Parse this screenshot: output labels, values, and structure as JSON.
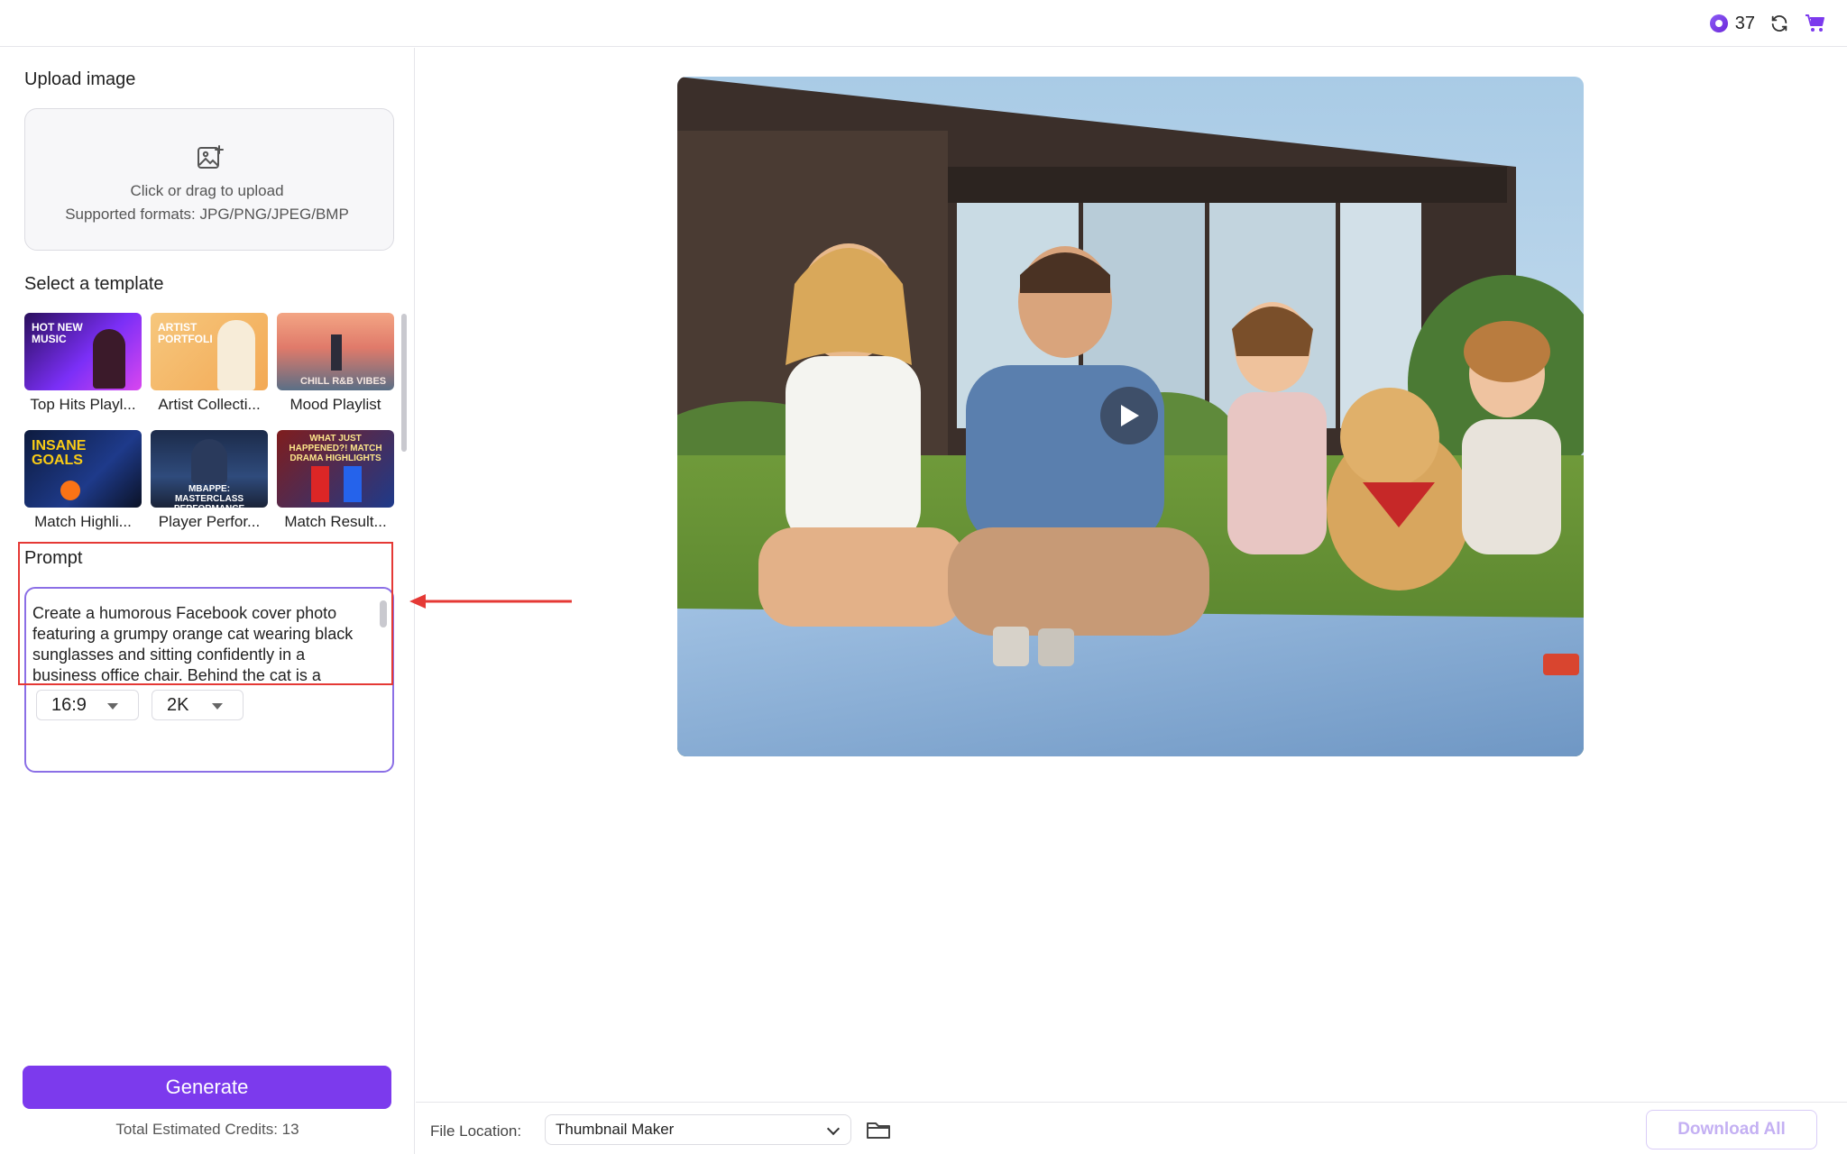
{
  "topbar": {
    "credits": "37",
    "icons": [
      "credit-gem-icon",
      "refresh-icon",
      "cart-icon"
    ]
  },
  "upload": {
    "title": "Upload image",
    "main_text": "Click or drag to upload",
    "formats_text": "Supported formats: JPG/PNG/JPEG/BMP",
    "icon": "image-add-icon"
  },
  "templates": {
    "title": "Select a template",
    "items": [
      {
        "label": "Top Hits Playl...",
        "thumb_text": "HOT NEW MUSIC"
      },
      {
        "label": "Artist Collecti...",
        "thumb_text": "ARTIST PORTFOLI"
      },
      {
        "label": "Mood Playlist",
        "thumb_text": "CHILL R&B VIBES"
      },
      {
        "label": "Match Highli...",
        "thumb_text": "INSANE GOALS"
      },
      {
        "label": "Player Perfor...",
        "thumb_text": "MBAPPE: MASTERCLASS PERFORMANCE"
      },
      {
        "label": "Match Result...",
        "thumb_text": "WHAT JUST HAPPENED?! MATCH DRAMA HIGHLIGHTS"
      }
    ]
  },
  "prompt": {
    "title": "Prompt",
    "text": "Create a humorous Facebook cover photo featuring a grumpy orange cat wearing black sunglasses and sitting confidently in a business office chair. Behind the cat is a",
    "aspect_ratio": "16:9",
    "resolution": "2K"
  },
  "actions": {
    "generate_label": "Generate",
    "credits_note": "Total Estimated Credits: 13"
  },
  "bottombar": {
    "file_location_label": "File Location:",
    "file_location_value": "Thumbnail Maker",
    "download_all_label": "Download All"
  },
  "colors": {
    "accent": "#7c3aed",
    "highlight": "#e53935",
    "prompt_border": "#8b6fe6"
  }
}
